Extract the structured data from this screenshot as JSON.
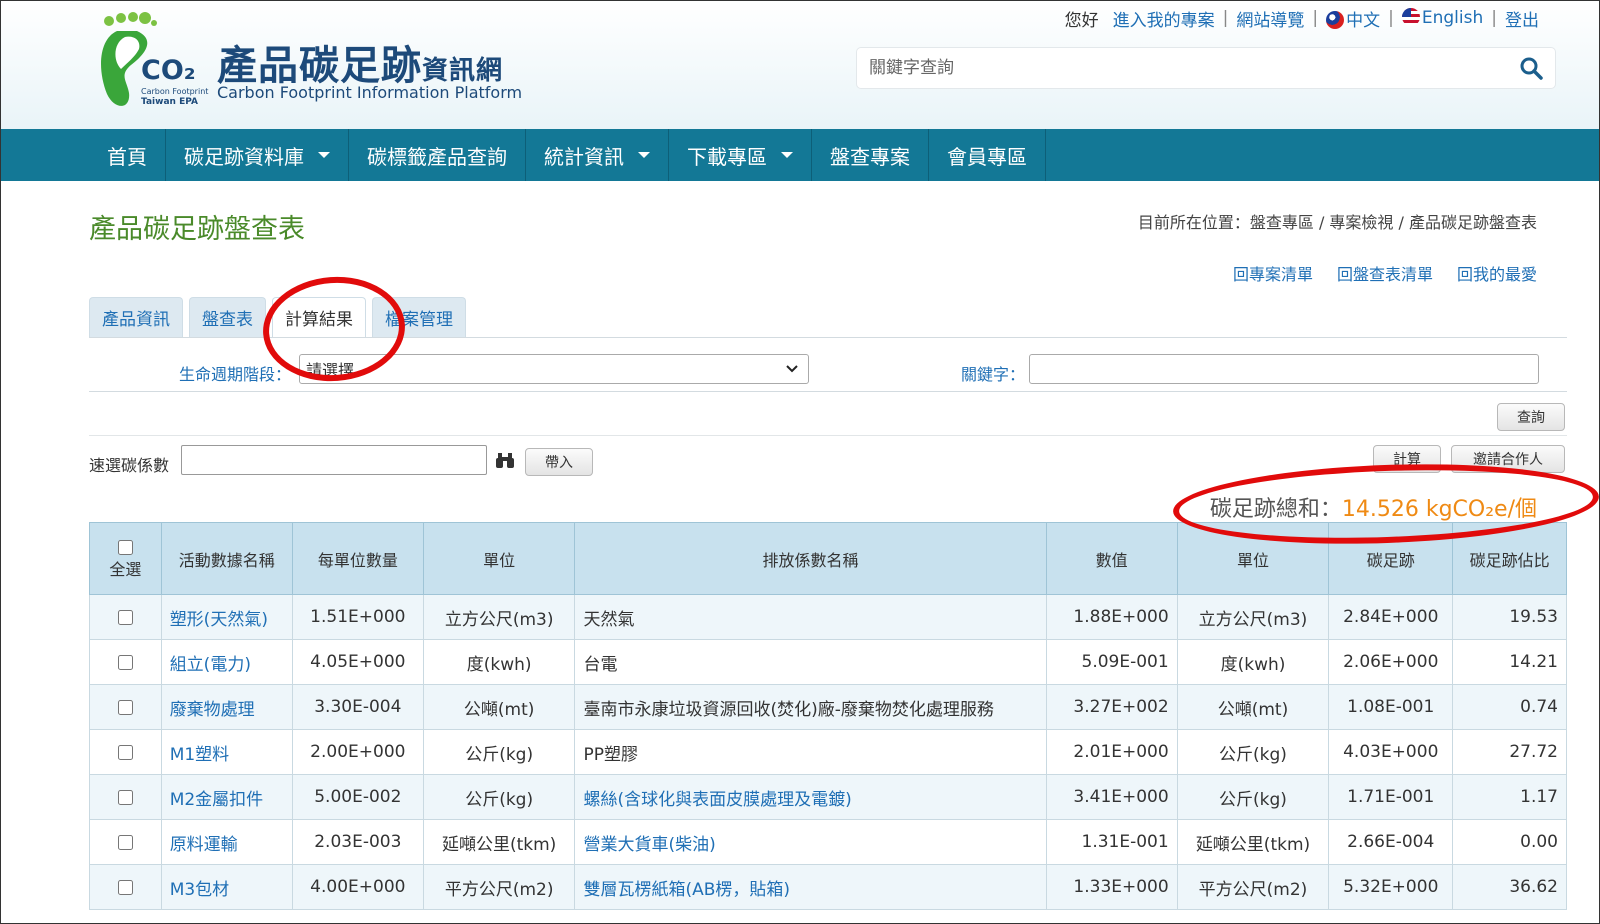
{
  "header": {
    "logo_title": "產品碳足跡",
    "logo_title_small": "資訊網",
    "logo_subtitle": "Carbon Footprint Information Platform",
    "logo_co2": "CO₂",
    "logo_mini1": "Carbon Footprint",
    "logo_mini2": "Taiwan EPA",
    "greeting": "您好",
    "links": {
      "my_project": "進入我的專案",
      "sitemap": "網站導覽",
      "chinese": "中文",
      "english": "English",
      "logout": "登出"
    },
    "search_placeholder": "關鍵字查詢"
  },
  "nav": {
    "items": [
      "首頁",
      "碳足跡資料庫",
      "碳標籤產品查詢",
      "統計資訊",
      "下載專區",
      "盤查專案",
      "會員專區"
    ]
  },
  "page": {
    "title": "產品碳足跡盤查表",
    "breadcrumb": "目前所在位置：盤查專區 / 專案檢視 / 產品碳足跡盤查表",
    "quicklinks": [
      "回專案清單",
      "回盤查表清單",
      "回我的最愛"
    ],
    "tabs": [
      "產品資訊",
      "盤查表",
      "計算結果",
      "檔案管理"
    ],
    "active_tab": "計算結果"
  },
  "filters": {
    "lifecycle_label": "生命週期階段：",
    "lifecycle_value": "請選擇",
    "keyword_label": "關鍵字：",
    "query_button": "查詢",
    "quick_label": "速選碳係數",
    "import_button": "帶入",
    "calc_button": "計算",
    "invite_button": "邀請合作人"
  },
  "total": {
    "label": "碳足跡總和：",
    "value": "14.526  kgCO₂e/個"
  },
  "table": {
    "select_all": "全選",
    "headers": [
      "活動數據名稱",
      "每單位數量",
      "單位",
      "排放係數名稱",
      "數值",
      "單位",
      "碳足跡",
      "碳足跡佔比"
    ],
    "rows": [
      [
        "塑形(天然氣)",
        "1.51E+000",
        "立方公尺(m3)",
        "天然氣",
        "1.88E+000",
        "立方公尺(m3)",
        "2.84E+000",
        "19.53"
      ],
      [
        "組立(電力)",
        "4.05E+000",
        "度(kwh)",
        "台電",
        "5.09E-001",
        "度(kwh)",
        "2.06E+000",
        "14.21"
      ],
      [
        "廢棄物處理",
        "3.30E-004",
        "公噸(mt)",
        "臺南市永康垃圾資源回收(焚化)廠-廢棄物焚化處理服務",
        "3.27E+002",
        "公噸(mt)",
        "1.08E-001",
        "0.74"
      ],
      [
        "M1塑料",
        "2.00E+000",
        "公斤(kg)",
        "PP塑膠",
        "2.01E+000",
        "公斤(kg)",
        "4.03E+000",
        "27.72"
      ],
      [
        "M2金屬扣件",
        "5.00E-002",
        "公斤(kg)",
        "螺絲(含球化與表面皮膜處理及電鍍)",
        "3.41E+000",
        "公斤(kg)",
        "1.71E-001",
        "1.17"
      ],
      [
        "原料運輸",
        "2.03E-003",
        "延噸公里(tkm)",
        "營業大貨車(柴油)",
        "1.31E-001",
        "延噸公里(tkm)",
        "2.66E-004",
        "0.00"
      ],
      [
        "M3包材",
        "4.00E+000",
        "平方公尺(m2)",
        "雙層瓦楞紙箱(AB楞，貼箱)",
        "1.33E+000",
        "平方公尺(m2)",
        "5.32E+000",
        "36.62"
      ]
    ],
    "linked_factor_rows": [
      4,
      5,
      6
    ]
  },
  "colors": {
    "nav_bg": "#137896",
    "link": "#1f6fb5",
    "title_green": "#4a8a2a",
    "total_orange": "#ef8a14",
    "annotation_red": "#e10b0b"
  }
}
